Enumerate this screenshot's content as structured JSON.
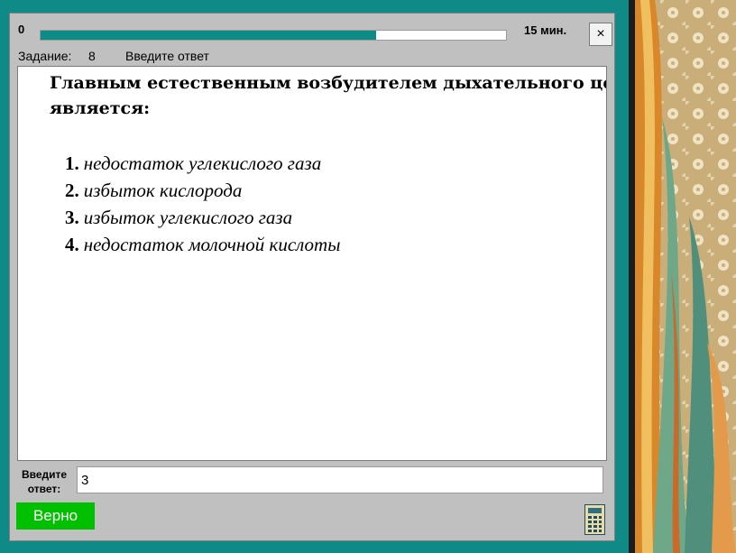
{
  "timer": {
    "start": "0",
    "end": "15 мин.",
    "progress": 0.72
  },
  "window": {
    "close_label": "×"
  },
  "task": {
    "label": "Задание:",
    "number": "8",
    "mode": "Введите ответ"
  },
  "question": {
    "line1": "Главным естественным возбудителем дыхательного центр",
    "line2": "является:",
    "answers": [
      {
        "num": "1.",
        "text": "недостаток углекислого газа"
      },
      {
        "num": "2.",
        "text": "избыток кислорода"
      },
      {
        "num": "3.",
        "text": "избыток углекислого газа"
      },
      {
        "num": "4.",
        "text": "недостаток молочной кислоты"
      }
    ]
  },
  "answer_box": {
    "label_line1": "Введите",
    "label_line2": "ответ:",
    "value": "3"
  },
  "result": {
    "label": "Верно",
    "color": "#00c000"
  },
  "icons": {
    "calculator": "calculator-icon",
    "close": "close-icon"
  },
  "colors": {
    "background": "#0f8a86",
    "progress": "#0d8b85",
    "panel": "#c0c0c0"
  }
}
